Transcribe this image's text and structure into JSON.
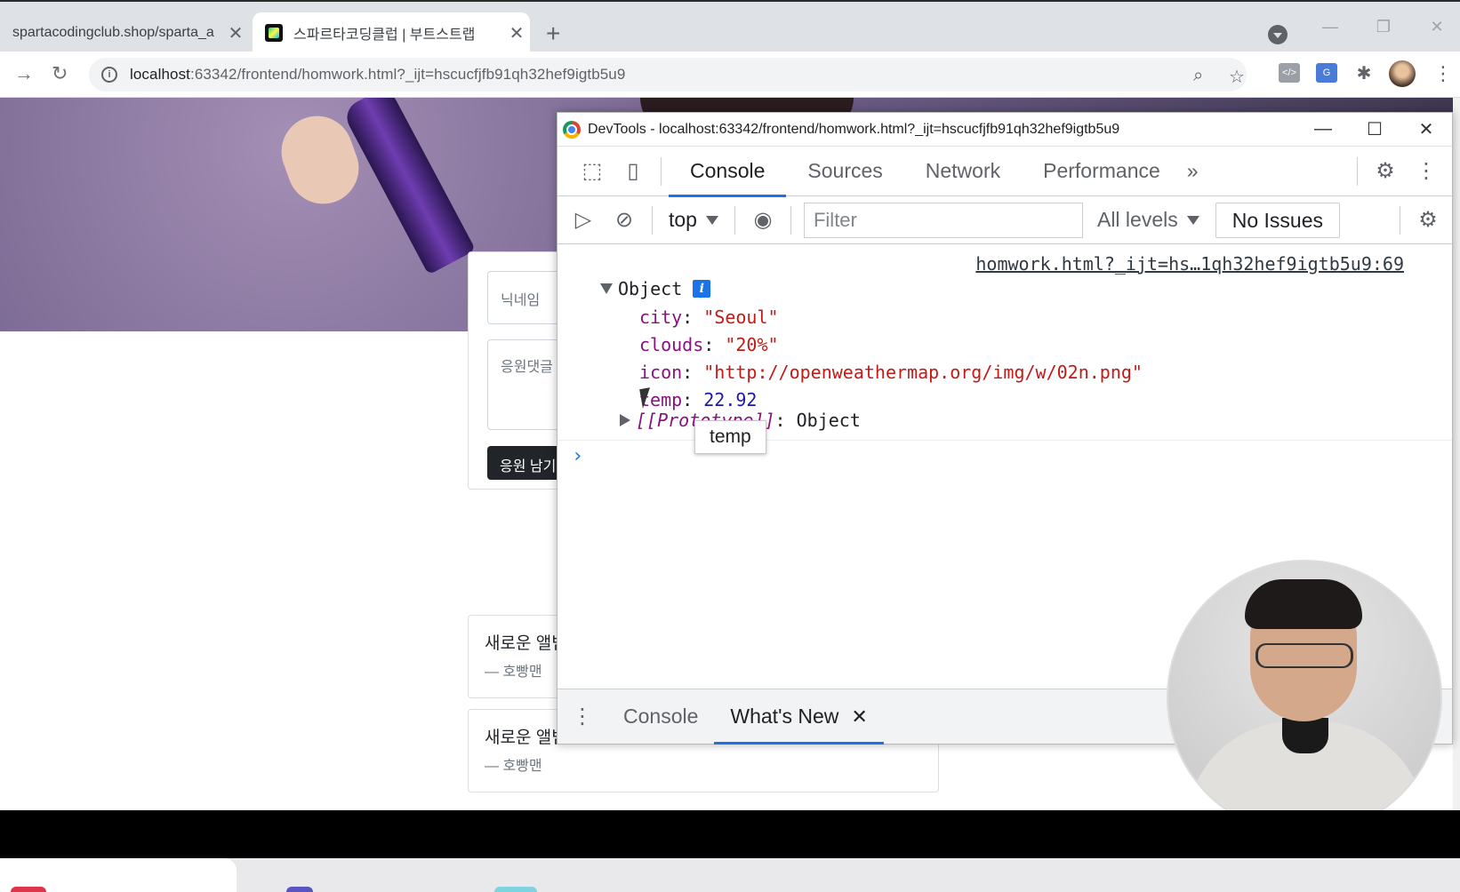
{
  "browser": {
    "tabs": [
      {
        "title": "spartacodingclub.shop/sparta_a",
        "active": false
      },
      {
        "title": "스파르타코딩클럽 | 부트스트랩",
        "active": true
      }
    ],
    "url_host": "localhost",
    "url_rest": ":63342/frontend/homwork.html?_ijt=hscucfjfb91qh32hef9igtb5u9"
  },
  "page": {
    "nickname_placeholder": "닉네임",
    "comment_placeholder": "응원댓글",
    "cheer_button": "응원 남기기",
    "cards": [
      {
        "message": "새로운 앨범 너무 멋져요!",
        "author": "— 호빵맨"
      },
      {
        "message": "새로운 앨범 너무 멋져요!",
        "author": "— 호빵맨"
      }
    ]
  },
  "devtools": {
    "window_title": "DevTools - localhost:63342/frontend/homwork.html?_ijt=hscucfjfb91qh32hef9igtb5u9",
    "tabs": [
      "Console",
      "Sources",
      "Network",
      "Performance"
    ],
    "more": "»",
    "context": "top",
    "filter_placeholder": "Filter",
    "levels": "All levels",
    "issues": "No Issues",
    "console": {
      "source_link": "homwork.html?_ijt=hs…1qh32hef9igtb5u9:69",
      "object_label": "Object",
      "properties": [
        {
          "key": "city",
          "value": "\"Seoul\"",
          "kind": "str"
        },
        {
          "key": "clouds",
          "value": "\"20%\"",
          "kind": "str"
        },
        {
          "key": "icon",
          "value": "\"http://openweathermap.org/img/w/02n.png\"",
          "kind": "str"
        },
        {
          "key": "temp",
          "value": "22.92",
          "kind": "num"
        }
      ],
      "prototype_label": "[[Prototype]]",
      "prototype_value": ": Object",
      "tooltip": "temp"
    },
    "drawer_tabs": [
      "Console",
      "What's New"
    ]
  }
}
